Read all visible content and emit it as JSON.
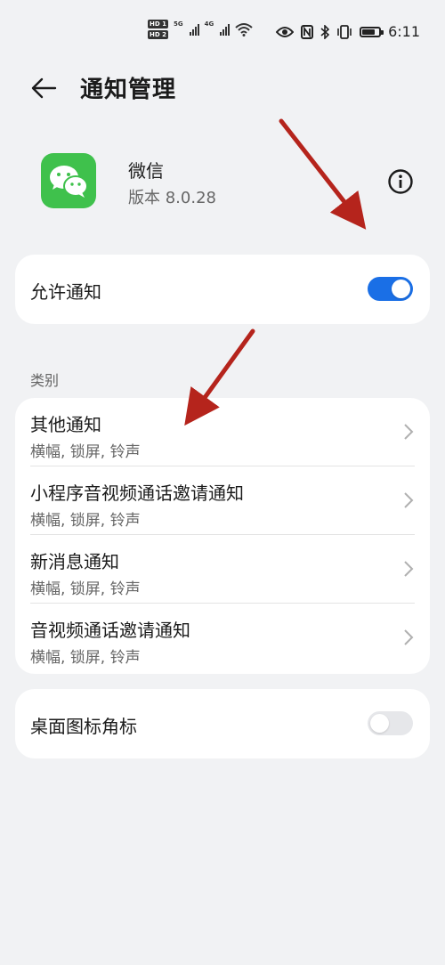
{
  "status_bar": {
    "hd1": "HD 1",
    "hd2": "HD 2",
    "net1": "5G",
    "net2": "4G",
    "time": "6:11",
    "battery_level": 0.75,
    "icons": [
      "hd-icon",
      "signal-icon",
      "wifi-icon",
      "eye-icon",
      "nfc-icon",
      "bluetooth-icon",
      "vibrate-icon",
      "battery-icon"
    ]
  },
  "header": {
    "title": "通知管理",
    "back_icon": "arrow-left-icon"
  },
  "app": {
    "name": "微信",
    "version": "版本 8.0.28",
    "icon": "wechat-icon",
    "info_icon": "info-icon",
    "icon_color": "#3fc14c"
  },
  "allow": {
    "label": "允许通知",
    "enabled": true
  },
  "category": {
    "label": "类别",
    "items": [
      {
        "title": "其他通知",
        "subtitle": "横幅, 锁屏, 铃声"
      },
      {
        "title": "小程序音视频通话邀请通知",
        "subtitle": "横幅, 锁屏, 铃声"
      },
      {
        "title": "新消息通知",
        "subtitle": "横幅, 锁屏, 铃声"
      },
      {
        "title": "音视频通话邀请通知",
        "subtitle": "横幅, 锁屏, 铃声"
      }
    ]
  },
  "badge": {
    "label": "桌面图标角标",
    "enabled": false
  },
  "colors": {
    "accent": "#1a6fe6",
    "annotation_arrow": "#b5241c",
    "background": "#f1f2f4"
  }
}
